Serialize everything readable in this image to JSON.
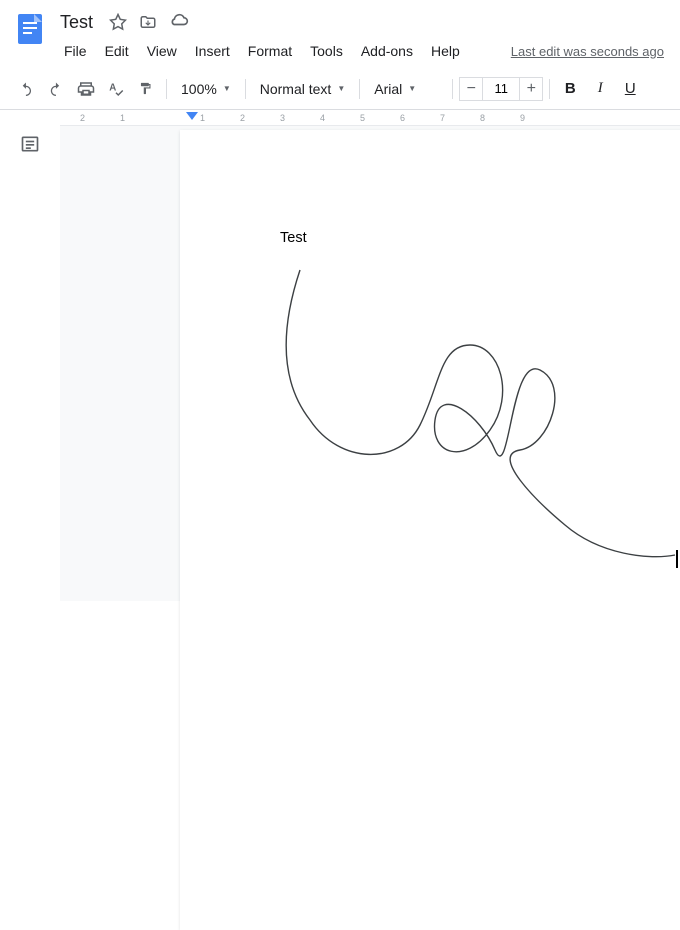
{
  "header": {
    "title": "Test",
    "last_edit": "Last edit was seconds ago"
  },
  "menubar": {
    "file": "File",
    "edit": "Edit",
    "view": "View",
    "insert": "Insert",
    "format": "Format",
    "tools": "Tools",
    "addons": "Add-ons",
    "help": "Help"
  },
  "toolbar": {
    "zoom": "100%",
    "style": "Normal text",
    "font": "Arial",
    "font_size": "11",
    "bold": "B",
    "italic": "I",
    "underline": "U"
  },
  "ruler": {
    "ticks": [
      "2",
      "1",
      "1",
      "2",
      "3",
      "4",
      "5",
      "6",
      "7",
      "8",
      "9"
    ]
  },
  "document": {
    "text": "Test"
  }
}
